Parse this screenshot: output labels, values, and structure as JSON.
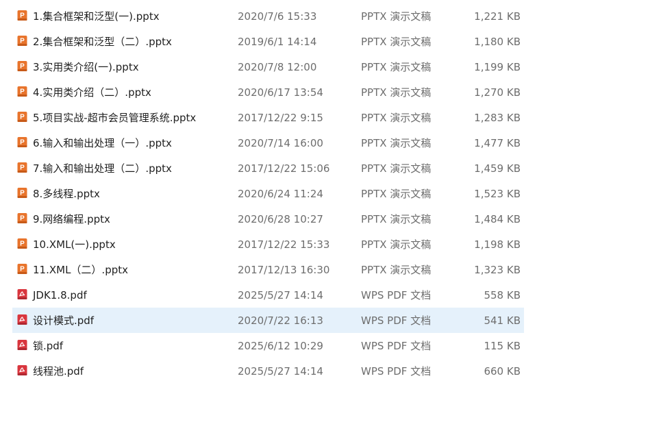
{
  "files": [
    {
      "name": "1.集合框架和泛型(一).pptx",
      "modified": "2020/7/6 15:33",
      "type": "PPTX 演示文稿",
      "size": "1,221 KB",
      "icon": "pptx-file-icon"
    },
    {
      "name": "2.集合框架和泛型（二）.pptx",
      "modified": "2019/6/1 14:14",
      "type": "PPTX 演示文稿",
      "size": "1,180 KB",
      "icon": "pptx-file-icon"
    },
    {
      "name": "3.实用类介绍(一).pptx",
      "modified": "2020/7/8 12:00",
      "type": "PPTX 演示文稿",
      "size": "1,199 KB",
      "icon": "pptx-file-icon"
    },
    {
      "name": "4.实用类介绍（二）.pptx",
      "modified": "2020/6/17 13:54",
      "type": "PPTX 演示文稿",
      "size": "1,270 KB",
      "icon": "pptx-file-icon"
    },
    {
      "name": "5.项目实战-超市会员管理系统.pptx",
      "modified": "2017/12/22 9:15",
      "type": "PPTX 演示文稿",
      "size": "1,283 KB",
      "icon": "pptx-file-icon"
    },
    {
      "name": "6.输入和输出处理（一）.pptx",
      "modified": "2020/7/14 16:00",
      "type": "PPTX 演示文稿",
      "size": "1,477 KB",
      "icon": "pptx-file-icon"
    },
    {
      "name": "7.输入和输出处理（二）.pptx",
      "modified": "2017/12/22 15:06",
      "type": "PPTX 演示文稿",
      "size": "1,459 KB",
      "icon": "pptx-file-icon"
    },
    {
      "name": "8.多线程.pptx",
      "modified": "2020/6/24 11:24",
      "type": "PPTX 演示文稿",
      "size": "1,523 KB",
      "icon": "pptx-file-icon"
    },
    {
      "name": "9.网络编程.pptx",
      "modified": "2020/6/28 10:27",
      "type": "PPTX 演示文稿",
      "size": "1,484 KB",
      "icon": "pptx-file-icon"
    },
    {
      "name": "10.XML(一).pptx",
      "modified": "2017/12/22 15:33",
      "type": "PPTX 演示文稿",
      "size": "1,198 KB",
      "icon": "pptx-file-icon"
    },
    {
      "name": "11.XML（二）.pptx",
      "modified": "2017/12/13 16:30",
      "type": "PPTX 演示文稿",
      "size": "1,323 KB",
      "icon": "pptx-file-icon"
    },
    {
      "name": "JDK1.8.pdf",
      "modified": "2025/5/27 14:14",
      "type": "WPS PDF 文档",
      "size": "558 KB",
      "icon": "pdf-file-icon"
    },
    {
      "name": "设计模式.pdf",
      "modified": "2020/7/22 16:13",
      "type": "WPS PDF 文档",
      "size": "541 KB",
      "icon": "pdf-file-icon",
      "selected": true
    },
    {
      "name": "锁.pdf",
      "modified": "2025/6/12 10:29",
      "type": "WPS PDF 文档",
      "size": "115 KB",
      "icon": "pdf-file-icon"
    },
    {
      "name": "线程池.pdf",
      "modified": "2025/5/27 14:14",
      "type": "WPS PDF 文档",
      "size": "660 KB",
      "icon": "pdf-file-icon"
    }
  ],
  "colors": {
    "pptx_icon": "#e8742c",
    "pdf_icon": "#d9363e",
    "selected_row": "#e5f1fb",
    "meta_text": "#6d6d6d"
  }
}
